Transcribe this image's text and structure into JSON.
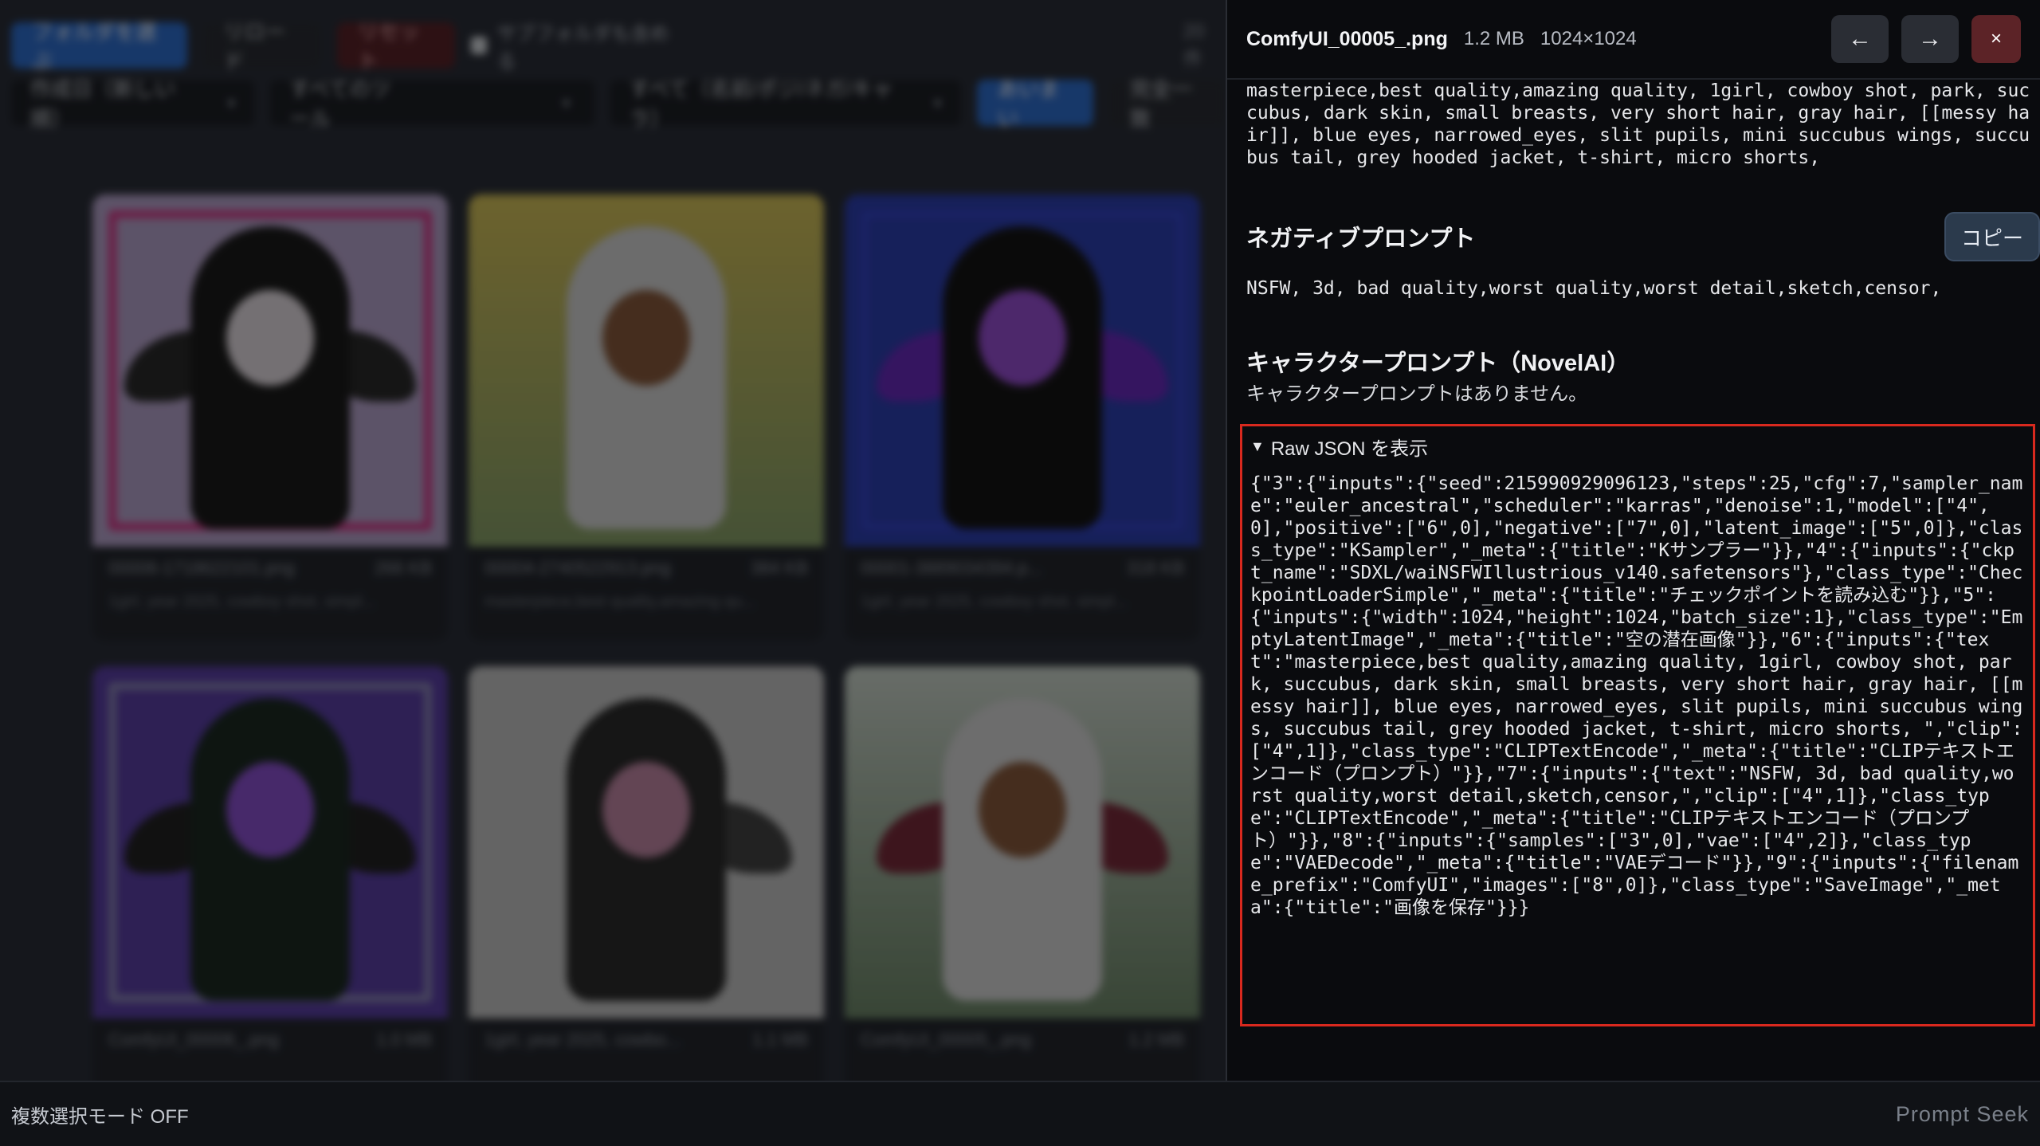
{
  "gallery": {
    "toolbar": {
      "choose_folder": "フォルダを選ぶ",
      "reload": "リロード",
      "reset": "リセット",
      "include_subfolders": "サブフォルダも含める",
      "count": "20 件",
      "sort": "作成日（新しい順）",
      "tool_filter": "すべてのツール",
      "scope_filter": "すべて（名前/ポジ/ネガ/キャラ）",
      "match_fuzzy": "あいまい",
      "match_exact": "完全一致"
    },
    "cards": [
      {
        "name": "00006-1718622101.png",
        "size": "266 KB",
        "snippet": "1girl, year 2025, cowboy shot, simpl..."
      },
      {
        "name": "00004-2740522913.png",
        "size": "384 KB",
        "snippet": "masterpiece,best quality,amazing qu..."
      },
      {
        "name": "00001-3889034394.p...",
        "size": "318 KB",
        "snippet": "1girl, year 2025, cowboy shot, simpl..."
      },
      {
        "name": "ComfyUI_00006_.png",
        "size": "1.0 MB",
        "snippet": ""
      },
      {
        "name": "1girl, year 2025, cowbo...",
        "size": "1.1 MB",
        "snippet": ""
      },
      {
        "name": "ComfyUI_00005_.png",
        "size": "1.2 MB",
        "snippet": ""
      }
    ]
  },
  "status": {
    "multi_select": "複数選択モード OFF",
    "app_name": "Prompt Seek"
  },
  "panel": {
    "filename": "ComfyUI_00005_.png",
    "filesize": "1.2 MB",
    "dimensions": "1024×1024",
    "prev_label": "←",
    "next_label": "→",
    "close_label": "×",
    "positive_text": "masterpiece,best quality,amazing quality, 1girl, cowboy shot, park, succubus, dark skin, small breasts, very short hair, gray hair, [[messy hair]], blue eyes, narrowed_eyes, slit pupils, mini succubus wings, succubus tail, grey hooded jacket, t-shirt, micro shorts,",
    "negative_title": "ネガティブプロンプト",
    "copy_label": "コピー",
    "negative_text": "NSFW, 3d, bad quality,worst quality,worst detail,sketch,censor,",
    "character_title": "キャラクタープロンプト（NovelAI）",
    "character_empty": "キャラクタープロンプトはありません。",
    "raw_summary": "Raw JSON を表示",
    "raw_json": "{\"3\":{\"inputs\":{\"seed\":215990929096123,\"steps\":25,\"cfg\":7,\"sampler_name\":\"euler_ancestral\",\"scheduler\":\"karras\",\"denoise\":1,\"model\":[\"4\",0],\"positive\":[\"6\",0],\"negative\":[\"7\",0],\"latent_image\":[\"5\",0]},\"class_type\":\"KSampler\",\"_meta\":{\"title\":\"Kサンプラー\"}},\"4\":{\"inputs\":{\"ckpt_name\":\"SDXL/waiNSFWIllustrious_v140.safetensors\"},\"class_type\":\"CheckpointLoaderSimple\",\"_meta\":{\"title\":\"チェックポイントを読み込む\"}},\"5\":{\"inputs\":{\"width\":1024,\"height\":1024,\"batch_size\":1},\"class_type\":\"EmptyLatentImage\",\"_meta\":{\"title\":\"空の潜在画像\"}},\"6\":{\"inputs\":{\"text\":\"masterpiece,best quality,amazing quality, 1girl, cowboy shot, park, succubus, dark skin, small breasts, very short hair, gray hair, [[messy hair]], blue eyes, narrowed_eyes, slit pupils, mini succubus wings, succubus tail, grey hooded jacket, t-shirt, micro shorts, \",\"clip\":[\"4\",1]},\"class_type\":\"CLIPTextEncode\",\"_meta\":{\"title\":\"CLIPテキストエンコード（プロンプト）\"}},\"7\":{\"inputs\":{\"text\":\"NSFW, 3d, bad quality,worst quality,worst detail,sketch,censor,\",\"clip\":[\"4\",1]},\"class_type\":\"CLIPTextEncode\",\"_meta\":{\"title\":\"CLIPテキストエンコード（プロンプト）\"}},\"8\":{\"inputs\":{\"samples\":[\"3\",0],\"vae\":[\"4\",2]},\"class_type\":\"VAEDecode\",\"_meta\":{\"title\":\"VAEデコード\"}},\"9\":{\"inputs\":{\"filename_prefix\":\"ComfyUI\",\"images\":[\"8\",0]},\"class_type\":\"SaveImage\",\"_meta\":{\"title\":\"画像を保存\"}}}",
    "icons": {
      "prev": "arrow-left-icon",
      "next": "arrow-right-icon",
      "close": "close-icon",
      "disclosure": "triangle-down-icon"
    }
  },
  "colors": {
    "highlight_border": "#d9291e",
    "primary": "#2e6fd1",
    "danger": "#5c2327"
  }
}
